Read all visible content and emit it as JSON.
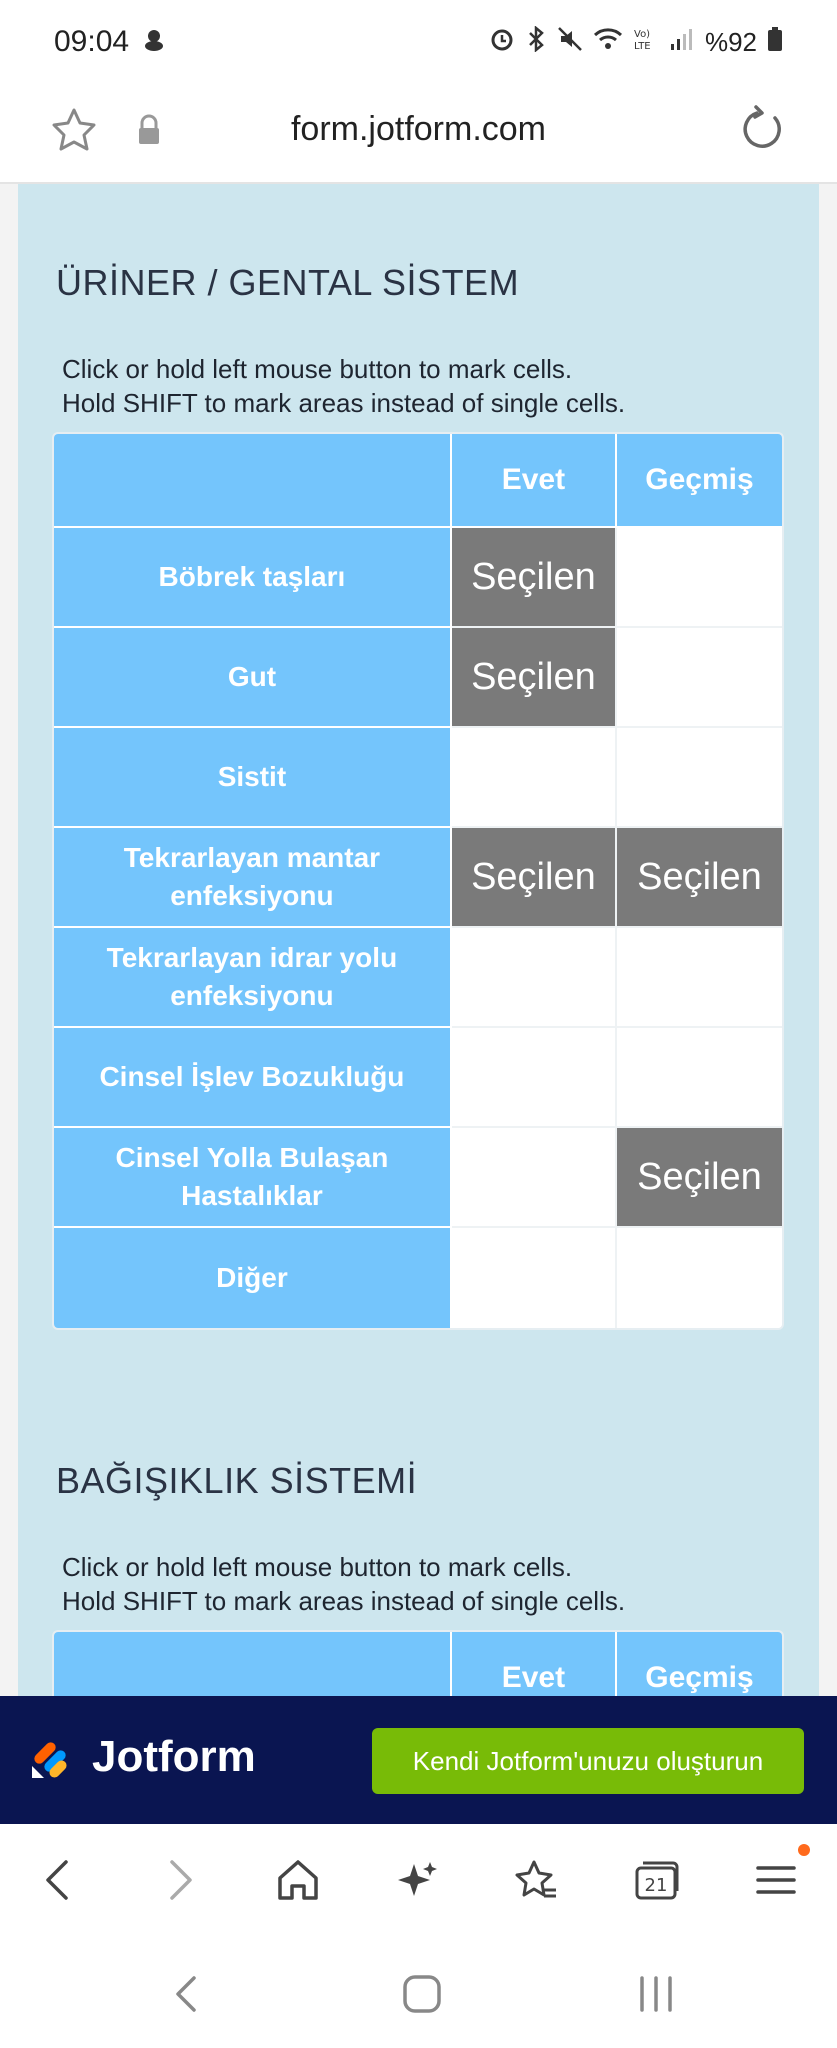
{
  "status_bar": {
    "time": "09:04",
    "battery": "%92"
  },
  "browser": {
    "url": "form.jotform.com"
  },
  "sections": [
    {
      "title": "ÜRİNER / GENTAL SİSTEM",
      "instructions_line1": "Click or hold left mouse button to mark cells.",
      "instructions_line2": "Hold SHIFT to mark areas instead of single cells.",
      "columns": [
        "Evet",
        "Geçmiş"
      ],
      "rows": [
        {
          "label": "Böbrek taşları",
          "cells": [
            "Seçilen",
            ""
          ]
        },
        {
          "label": "Gut",
          "cells": [
            "Seçilen",
            ""
          ]
        },
        {
          "label": "Sistit",
          "cells": [
            "",
            ""
          ]
        },
        {
          "label": "Tekrarlayan mantar enfeksiyonu",
          "cells": [
            "Seçilen",
            "Seçilen"
          ]
        },
        {
          "label": "Tekrarlayan idrar yolu enfeksiyonu",
          "cells": [
            "",
            ""
          ]
        },
        {
          "label": "Cinsel İşlev Bozukluğu",
          "cells": [
            "",
            ""
          ]
        },
        {
          "label": "Cinsel Yolla Bulaşan Hastalıklar",
          "cells": [
            "",
            "Seçilen"
          ]
        },
        {
          "label": "Diğer",
          "cells": [
            "",
            ""
          ]
        }
      ]
    },
    {
      "title": "BAĞIŞIKLIK SİSTEMİ",
      "instructions_line1": "Click or hold left mouse button to mark cells.",
      "instructions_line2": "Hold SHIFT to mark areas instead of single cells.",
      "columns": [
        "Evet",
        "Geçmiş"
      ]
    }
  ],
  "banner": {
    "brand": "Jotform",
    "cta": "Kendi Jotform'unuzu oluşturun",
    "brand_color": "#0a1551",
    "cta_color": "#78bb07"
  },
  "bottom_nav": {
    "tabs_count": "21"
  },
  "colors": {
    "header_blue": "#74c5fc",
    "panel_bg": "#cde6ee",
    "selected_gray": "#7a7a7a"
  }
}
